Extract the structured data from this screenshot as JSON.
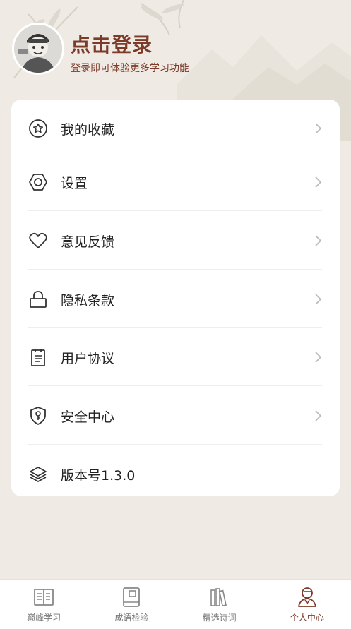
{
  "profile": {
    "login_title": "点击登录",
    "login_subtitle": "登录即可体验更多学习功能"
  },
  "menu": [
    {
      "label": "我的收藏",
      "icon": "star-circle-icon",
      "has_chevron": true
    },
    {
      "label": "设置",
      "icon": "hexagon-settings-icon",
      "has_chevron": true
    },
    {
      "label": "意见反馈",
      "icon": "heart-icon",
      "has_chevron": true
    },
    {
      "label": "隐私条款",
      "icon": "lock-icon",
      "has_chevron": true
    },
    {
      "label": "用户协议",
      "icon": "clipboard-icon",
      "has_chevron": true
    },
    {
      "label": "安全中心",
      "icon": "shield-key-icon",
      "has_chevron": true
    },
    {
      "label": "版本号1.3.0",
      "icon": "layers-icon",
      "has_chevron": false
    }
  ],
  "tabs": [
    {
      "label": "巅峰学习",
      "icon": "open-book-icon",
      "active": false
    },
    {
      "label": "成语检验",
      "icon": "notebook-icon",
      "active": false
    },
    {
      "label": "精选诗词",
      "icon": "bookshelf-icon",
      "active": false
    },
    {
      "label": "个人中心",
      "icon": "person-icon",
      "active": true
    }
  ],
  "colors": {
    "accent": "#7c3a28",
    "background": "#efebe4",
    "card": "#ffffff",
    "tab_inactive": "#777777"
  }
}
